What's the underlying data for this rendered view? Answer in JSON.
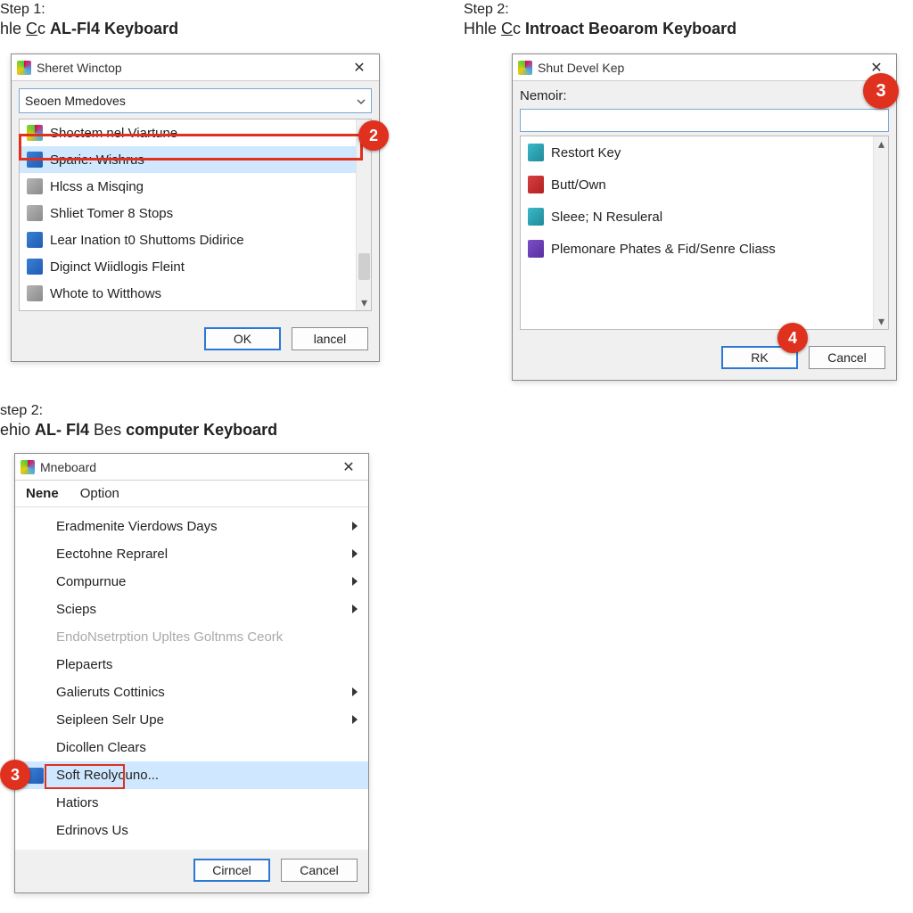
{
  "step1": {
    "label": "Step 1:",
    "title_pre": "hle ",
    "title_accent": "C",
    "title_mid": "c ",
    "title_bold": "AL-Fl4",
    "title_post": "  Keyboard",
    "window": {
      "title": "Sheret Winctop",
      "combo_value": "Seoen Mmedoves",
      "items": [
        {
          "label": "Shoctem nel Viartune",
          "icon": "multi"
        },
        {
          "label": "Sparie: Wishrus",
          "icon": "blue"
        },
        {
          "label": "Hlcss a Misqing",
          "icon": "gray"
        },
        {
          "label": "Shliet Tomer 8 Stops",
          "icon": "gray"
        },
        {
          "label": "Lear Ination t0 Shuttoms Didirice",
          "icon": "blue"
        },
        {
          "label": "Diginct Wiidlogis Fleint",
          "icon": "blue"
        },
        {
          "label": "Whote to Witthows",
          "icon": "gray"
        }
      ],
      "ok": "OK",
      "cancel": "lancel"
    }
  },
  "step2a": {
    "label": "Step 2:",
    "title_pre": "Hhle ",
    "title_accent": "C",
    "title_mid": "c ",
    "title_bold": "Introact Beoarom Keyboard",
    "window": {
      "title": "Shut Devel Kep",
      "field_label": "Nemoir:",
      "field_value": "",
      "items": [
        {
          "label": "Restort Key",
          "icon": "teal"
        },
        {
          "label": "Butt/Own",
          "icon": "red"
        },
        {
          "label": "Sleee; N Resuleral",
          "icon": "teal"
        },
        {
          "label": "Plemonare Phates & Fid/Senre Cliass",
          "icon": "purple"
        }
      ],
      "ok": "RK",
      "cancel": "Cancel"
    }
  },
  "step2b": {
    "label": "step 2:",
    "title_pre": "ehio ",
    "title_bold1": "AL- Fl4",
    "title_mid": " Bes ",
    "title_bold2": "computer Keyboard",
    "window": {
      "title": "Mneboard",
      "menubar": [
        "Nene",
        "Option"
      ],
      "items": [
        {
          "label": "Eradmenite Vierdows Days",
          "sub": true
        },
        {
          "label": "Eectohne Reprarel",
          "sub": true
        },
        {
          "label": "Compurnue",
          "sub": true
        },
        {
          "label": "Scieps",
          "sub": true
        },
        {
          "label": "EndoNsetrption Upltes Goltnms Ceork",
          "disabled": true
        },
        {
          "label": "Plepaerts"
        },
        {
          "label": "Galieruts Cottinics",
          "sub": true
        },
        {
          "label": "Seipleen Selr Upe",
          "sub": true
        },
        {
          "label": "Dicollen Clears"
        },
        {
          "label": "Soft Reolyouno...",
          "selected": true,
          "icon": true
        },
        {
          "label": "Hatiors"
        },
        {
          "label": "Edrinovs Us"
        }
      ],
      "ok": "Cirncel",
      "cancel": "Cancel"
    }
  },
  "callouts": {
    "c2": "2",
    "c3a": "3",
    "c4": "4",
    "c3b": "3"
  }
}
